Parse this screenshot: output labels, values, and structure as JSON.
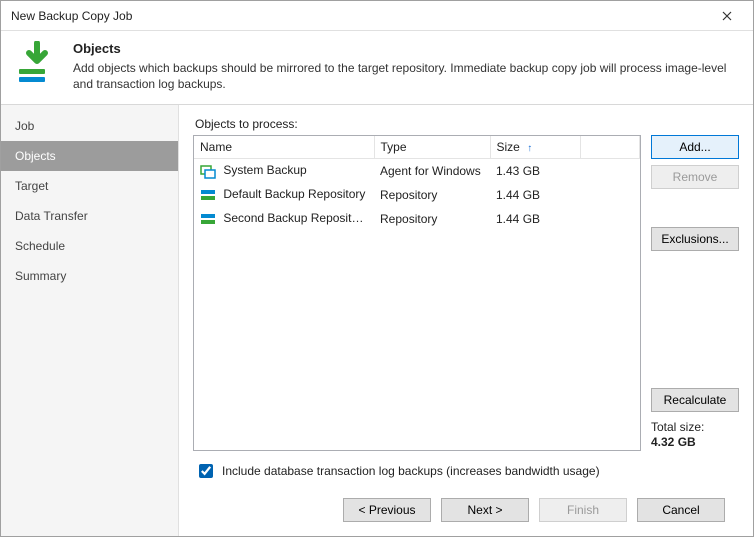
{
  "window": {
    "title": "New Backup Copy Job"
  },
  "header": {
    "title": "Objects",
    "description": "Add objects which backups should be mirrored to the target repository. Immediate backup copy job will process image-level and transaction log backups."
  },
  "sidebar": {
    "items": [
      {
        "label": "Job"
      },
      {
        "label": "Objects",
        "active": true
      },
      {
        "label": "Target"
      },
      {
        "label": "Data Transfer"
      },
      {
        "label": "Schedule"
      },
      {
        "label": "Summary"
      }
    ]
  },
  "main": {
    "section_label": "Objects to process:",
    "columns": {
      "name": "Name",
      "type": "Type",
      "size": "Size"
    },
    "sort": {
      "column": "size",
      "dir": "asc"
    },
    "rows": [
      {
        "icon": "system-backup-icon",
        "name": "System Backup",
        "type": "Agent for Windows",
        "size": "1.43 GB"
      },
      {
        "icon": "repository-icon",
        "name": "Default Backup Repository",
        "type": "Repository",
        "size": "1.44 GB"
      },
      {
        "icon": "repository-icon",
        "name": "Second Backup Repository",
        "type": "Repository",
        "size": "1.44 GB"
      }
    ],
    "buttons": {
      "add": "Add...",
      "remove": "Remove",
      "exclusions": "Exclusions...",
      "recalculate": "Recalculate"
    },
    "total_label": "Total size:",
    "total_value": "4.32 GB",
    "checkbox_label": "Include database transaction log backups (increases bandwidth usage)",
    "checkbox_checked": true
  },
  "footer": {
    "previous": "< Previous",
    "next": "Next >",
    "finish": "Finish",
    "cancel": "Cancel"
  }
}
